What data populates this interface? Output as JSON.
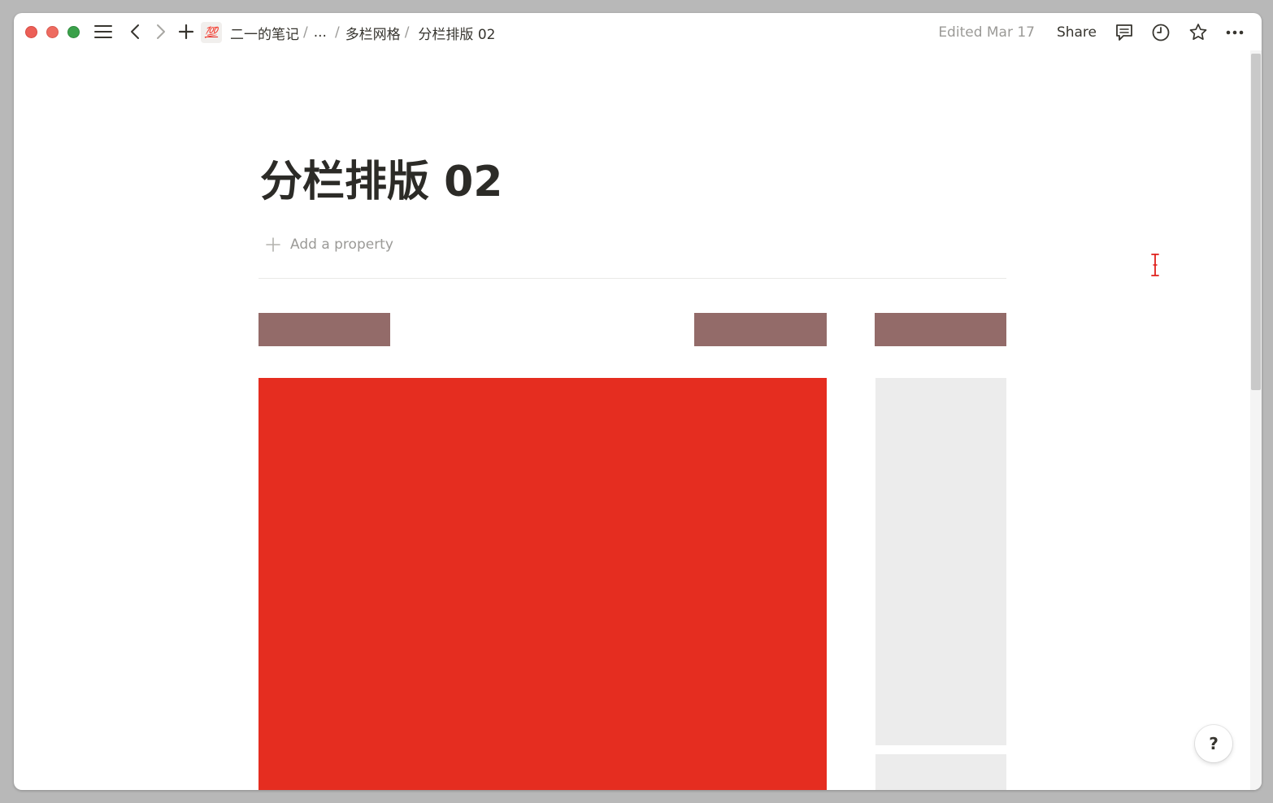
{
  "titlebar": {
    "page_emoji": "💯",
    "breadcrumb": {
      "workspace": "二一的笔记",
      "ellipsis": "...",
      "parent": "多栏网格",
      "current": "分栏排版 02",
      "separator": "/"
    },
    "edited": "Edited Mar 17",
    "share_label": "Share",
    "icons": [
      "menu-icon",
      "back-arrow-icon",
      "forward-arrow-icon",
      "new-page-plus-icon",
      "comment-icon",
      "history-clock-icon",
      "favorite-star-icon",
      "more-dots-icon"
    ]
  },
  "page": {
    "title": "分栏排版 02",
    "add_property_label": "Add a property"
  },
  "help": {
    "label": "?"
  },
  "colors": {
    "header_block": "#936b69",
    "red_block": "#e52d20",
    "grey_block": "#ececec",
    "traffic_close": "#ec5f57",
    "traffic_minimize": "#ee6b60",
    "traffic_maximize": "#3aa14a",
    "cursor": "#e0201b"
  }
}
